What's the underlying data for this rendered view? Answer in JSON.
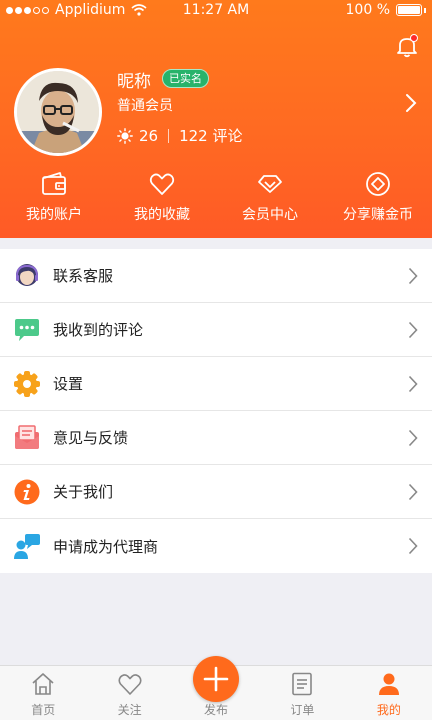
{
  "status_bar": {
    "carrier": "Applidium",
    "time": "11:27 AM",
    "battery": "100 %"
  },
  "profile": {
    "nickname": "昵称",
    "verified_badge": "已实名",
    "member_level": "普通会员",
    "points": "26",
    "comments": "122 评论"
  },
  "quick_actions": [
    {
      "label": "我的账户",
      "icon": "wallet-icon"
    },
    {
      "label": "我的收藏",
      "icon": "heart-icon"
    },
    {
      "label": "会员中心",
      "icon": "diamond-icon"
    },
    {
      "label": "分享赚金币",
      "icon": "coin-icon"
    }
  ],
  "menu": [
    {
      "label": "联系客服",
      "icon": "customer-service-icon"
    },
    {
      "label": "我收到的评论",
      "icon": "comment-icon"
    },
    {
      "label": "设置",
      "icon": "settings-icon"
    },
    {
      "label": "意见与反馈",
      "icon": "feedback-icon"
    },
    {
      "label": "关于我们",
      "icon": "info-icon"
    },
    {
      "label": "申请成为代理商",
      "icon": "agent-icon"
    }
  ],
  "tabbar": [
    {
      "label": "首页",
      "icon": "home-icon"
    },
    {
      "label": "关注",
      "icon": "heart-outline-icon"
    },
    {
      "label": "发布",
      "icon": "plus-icon"
    },
    {
      "label": "订单",
      "icon": "order-icon"
    },
    {
      "label": "我的",
      "icon": "user-icon",
      "active": true
    }
  ],
  "colors": {
    "accent": "#ff6a1c",
    "verified": "#27b36a"
  }
}
